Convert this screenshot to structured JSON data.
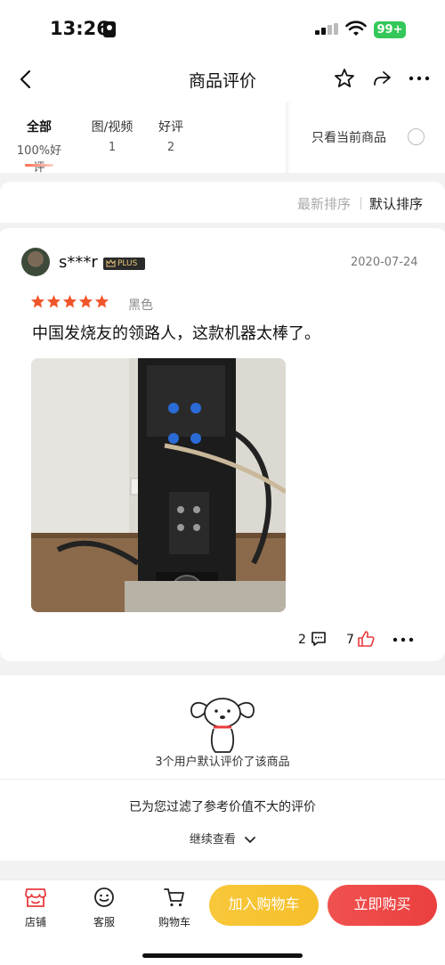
{
  "status_bar": {
    "time": "13:26",
    "battery": "99+"
  },
  "nav": {
    "title": "商品评价"
  },
  "filter": {
    "tabs": [
      {
        "label": "全部",
        "count": "100%好评"
      },
      {
        "label": "图/视频",
        "count": "1"
      },
      {
        "label": "好评",
        "count": "2"
      }
    ],
    "only_current": "只看当前商品"
  },
  "sort": {
    "latest": "最新排序",
    "default": "默认排序"
  },
  "review": {
    "username": "s***r",
    "badge": "PLUS",
    "date": "2020-07-24",
    "rating": 5,
    "variant": "黑色",
    "text": "中国发烧友的领路人，这款机器太棒了。",
    "reply_count": "2",
    "like_count": "7"
  },
  "summary": {
    "default_reviews": "3个用户默认评价了该商品",
    "filtered": "已为您过滤了参考价值不大的评价",
    "continue": "继续查看"
  },
  "bottom_bar": {
    "store": "店铺",
    "service": "客服",
    "cart": "购物车",
    "add_to_cart": "加入购物车",
    "buy_now": "立即购买"
  },
  "colors": {
    "accent_red": "#e93b3d",
    "accent_yellow": "#f8c83b",
    "star": "#f0552a"
  }
}
